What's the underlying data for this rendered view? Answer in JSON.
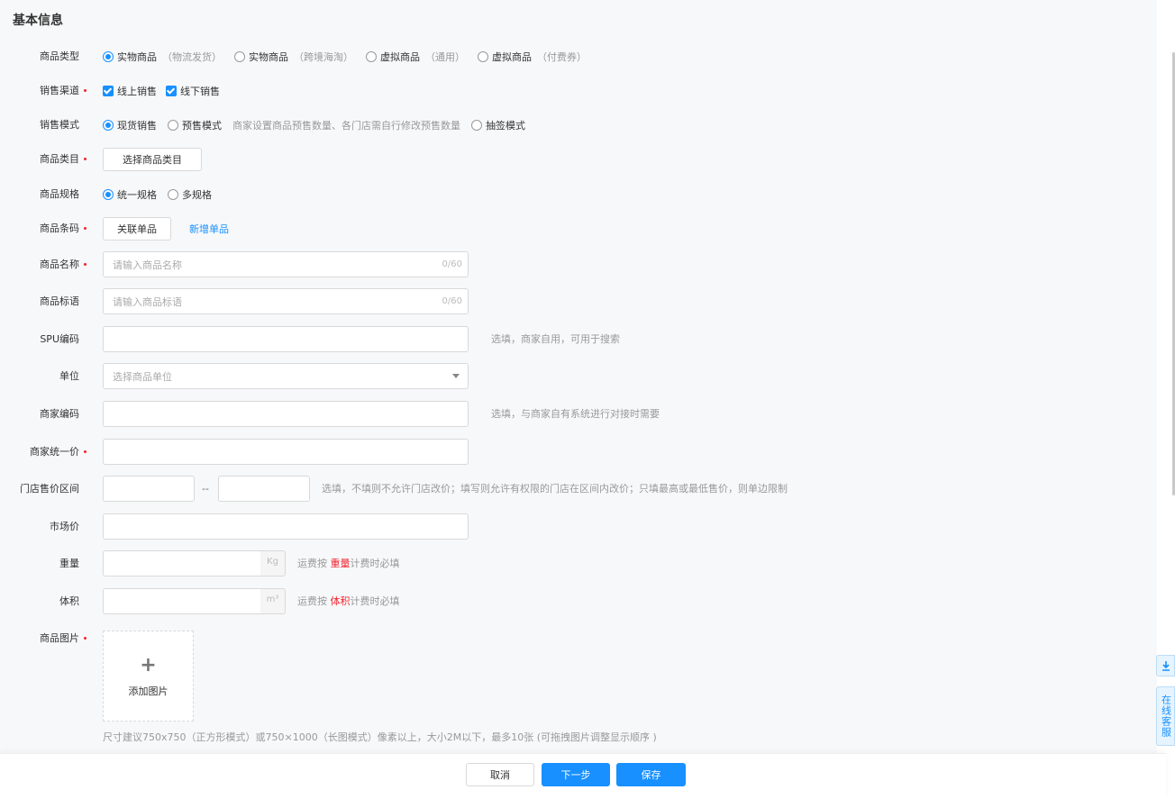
{
  "section": {
    "title": "基本信息"
  },
  "product_type": {
    "label": "商品类型",
    "options": [
      {
        "label": "实物商品",
        "hint": "（物流发货）"
      },
      {
        "label": "实物商品",
        "hint": "（跨境海淘）"
      },
      {
        "label": "虚拟商品",
        "hint": "（通用）"
      },
      {
        "label": "虚拟商品",
        "hint": "（付费券）"
      }
    ],
    "selected": "实物商品（物流发货）"
  },
  "sales_channel": {
    "label": "销售渠道",
    "options": [
      {
        "label": "线上销售",
        "checked": true
      },
      {
        "label": "线下销售",
        "checked": true
      }
    ]
  },
  "sales_mode": {
    "label": "销售模式",
    "options": [
      "现货销售",
      "预售模式",
      "抽签模式"
    ],
    "presale_desc": "商家设置商品预售数量、各门店需自行修改预售数量",
    "selected": "现货销售"
  },
  "category": {
    "label": "商品类目",
    "button": "选择商品类目"
  },
  "spec": {
    "label": "商品规格",
    "options": [
      "统一规格",
      "多规格"
    ],
    "selected": "统一规格"
  },
  "barcode": {
    "label": "商品条码",
    "button": "关联单品",
    "link": "新增单品"
  },
  "name": {
    "label": "商品名称",
    "placeholder": "请输入商品名称",
    "counter": "0/60"
  },
  "slogan": {
    "label": "商品标语",
    "placeholder": "请输入商品标语",
    "counter": "0/60"
  },
  "spu": {
    "label": "SPU编码",
    "desc": "选填，商家自用，可用于搜索"
  },
  "unit": {
    "label": "单位",
    "placeholder": "选择商品单位"
  },
  "merchant_code": {
    "label": "商家编码",
    "desc": "选填，与商家自有系统进行对接时需要"
  },
  "unified_price": {
    "label": "商家统一价"
  },
  "store_price_range": {
    "label": "门店售价区间",
    "separator": "--",
    "desc": "选填，不填则不允许门店改价；填写则允许有权限的门店在区间内改价；只填最高或最低售价，则单边限制"
  },
  "market_price": {
    "label": "市场价"
  },
  "weight": {
    "label": "重量",
    "unit": "Kg",
    "desc_prefix": "运费按 ",
    "desc_highlight": "重量",
    "desc_suffix": "计费时必填"
  },
  "volume": {
    "label": "体积",
    "unit": "m³",
    "desc_prefix": "运费按 ",
    "desc_highlight": "体积",
    "desc_suffix": "计费时必填"
  },
  "images": {
    "label": "商品图片",
    "add": "添加图片",
    "tip": "尺寸建议750x750（正方形模式）或750×1000（长图模式）像素以上，大小2M以下，最多10张 (可拖拽图片调整显示顺序 )"
  },
  "footer": {
    "cancel": "取消",
    "next": "下一步",
    "save": "保存"
  },
  "float": {
    "service": "在线客服"
  },
  "colors": {
    "primary": "#1890ff",
    "required": "#f5222d",
    "page_bg": "#f7f8fa"
  },
  "icons": {
    "add": "plus-icon",
    "download": "download-icon",
    "select": "caret-down-icon"
  }
}
